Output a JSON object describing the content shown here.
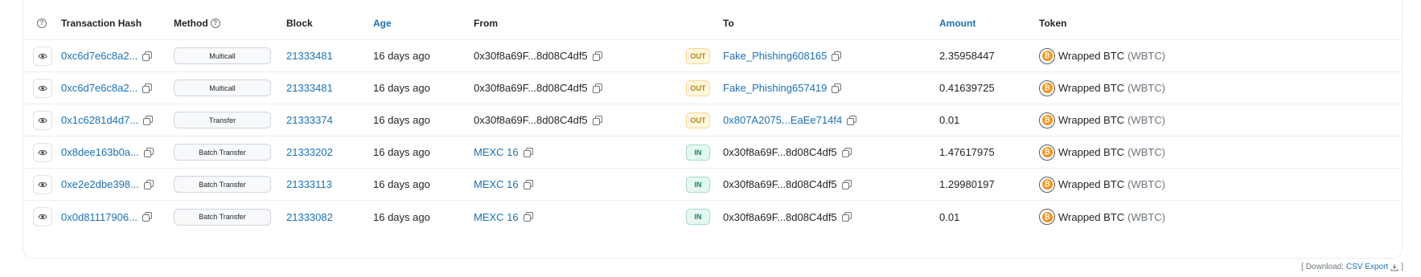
{
  "header": {
    "txhash": "Transaction Hash",
    "method": "Method",
    "block": "Block",
    "age": "Age",
    "from": "From",
    "to": "To",
    "amount": "Amount",
    "token": "Token",
    "info_glyph": "?"
  },
  "rows": [
    {
      "hash": "0xc6d7e6c8a2...",
      "method": "Multicall",
      "block": "21333481",
      "age": "16 days ago",
      "from": "0x30f8a69F...8d08C4df5",
      "dir": "OUT",
      "to": "Fake_Phishing608165",
      "amount": "2.35958447",
      "token_name": "Wrapped BTC",
      "token_symbol": "(WBTC)"
    },
    {
      "hash": "0xc6d7e6c8a2...",
      "method": "Multicall",
      "block": "21333481",
      "age": "16 days ago",
      "from": "0x30f8a69F...8d08C4df5",
      "dir": "OUT",
      "to": "Fake_Phishing657419",
      "amount": "0.41639725",
      "token_name": "Wrapped BTC",
      "token_symbol": "(WBTC)"
    },
    {
      "hash": "0x1c6281d4d7...",
      "method": "Transfer",
      "block": "21333374",
      "age": "16 days ago",
      "from": "0x30f8a69F...8d08C4df5",
      "dir": "OUT",
      "to": "0x807A2075...EaEe714f4",
      "amount": "0.01",
      "token_name": "Wrapped BTC",
      "token_symbol": "(WBTC)"
    },
    {
      "hash": "0x8dee163b0a...",
      "method": "Batch Transfer",
      "block": "21333202",
      "age": "16 days ago",
      "from": "MEXC 16",
      "dir": "IN",
      "to": "0x30f8a69F...8d08C4df5",
      "amount": "1.47617975",
      "token_name": "Wrapped BTC",
      "token_symbol": "(WBTC)"
    },
    {
      "hash": "0xe2e2dbe398...",
      "method": "Batch Transfer",
      "block": "21333113",
      "age": "16 days ago",
      "from": "MEXC 16",
      "dir": "IN",
      "to": "0x30f8a69F...8d08C4df5",
      "amount": "1.29980197",
      "token_name": "Wrapped BTC",
      "token_symbol": "(WBTC)"
    },
    {
      "hash": "0x0d81117906...",
      "method": "Batch Transfer",
      "block": "21333082",
      "age": "16 days ago",
      "from": "MEXC 16",
      "dir": "IN",
      "to": "0x30f8a69F...8d08C4df5",
      "amount": "0.01",
      "token_name": "Wrapped BTC",
      "token_symbol": "(WBTC)"
    }
  ],
  "icons": {
    "view": "eye-icon",
    "copy": "copy-icon",
    "token": "wbtc-token-icon",
    "download": "download-icon"
  },
  "token_glyph": "₿",
  "footer": {
    "open": "[ Download:",
    "link": "CSV Export",
    "close": "]"
  },
  "colors": {
    "link": "#1b71b5",
    "out_bg": "#fef6e0",
    "out_text": "#b7860b",
    "in_bg": "#e6f6f1",
    "in_text": "#0a8a63",
    "btc": "#f7931a"
  }
}
